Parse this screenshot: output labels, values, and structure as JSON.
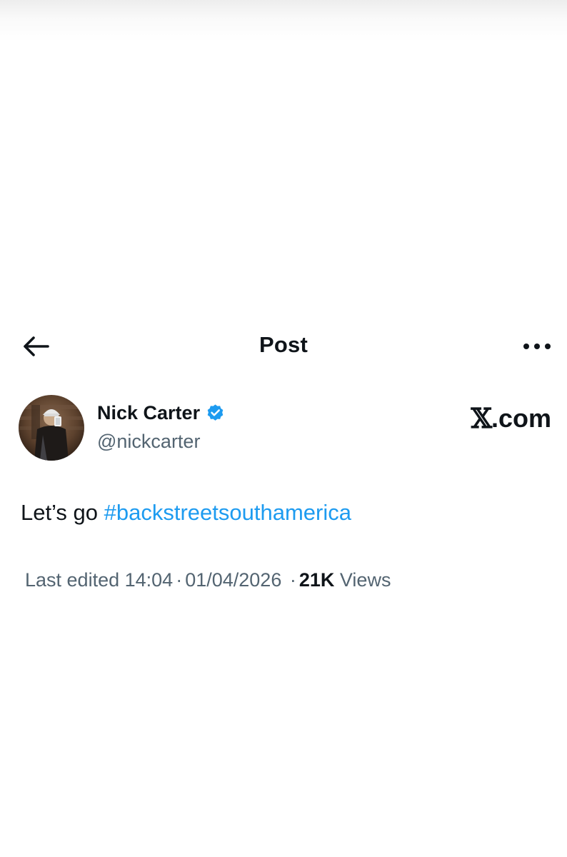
{
  "header": {
    "title": "Post",
    "back_icon": "arrow-left-icon",
    "more_icon": "more-horizontal-icon"
  },
  "author": {
    "display_name": "Nick Carter",
    "handle": "@nickcarter",
    "verified": true,
    "verified_icon": "verified-badge-icon",
    "verified_color": "#1d9bf0"
  },
  "brand": {
    "x_mark": "𝕏",
    "suffix": ".com"
  },
  "post": {
    "text_prefix": "Let’s go",
    "hashtag": "#backstreetsouthamerica",
    "hashtag_color": "#1d9bf0"
  },
  "meta": {
    "edited_label": "Last edited",
    "time": "14:04",
    "date": "01/04/2026",
    "views_count": "21K",
    "views_label": "Views",
    "separator": "·"
  }
}
